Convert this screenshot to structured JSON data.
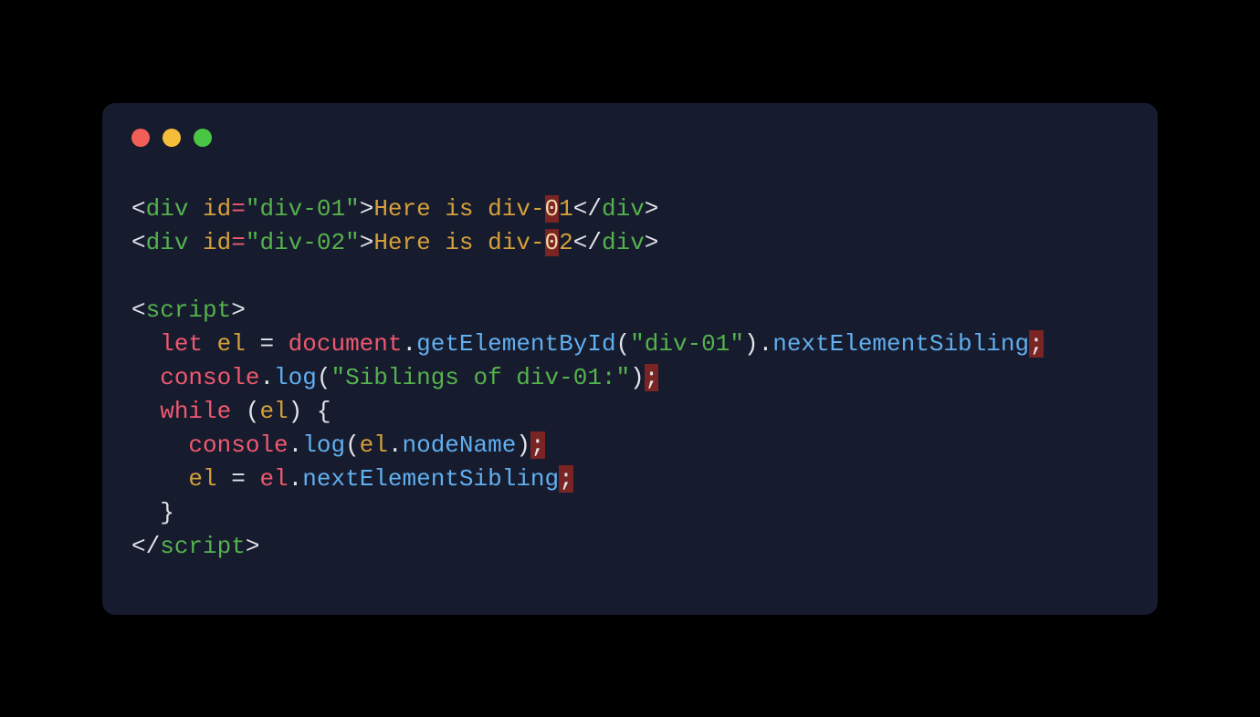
{
  "window": {
    "traffic_lights": {
      "red": "#f25f57",
      "yellow": "#f6bd3b",
      "green": "#4ac645"
    }
  },
  "code": {
    "l1": {
      "open": "<",
      "tag": "div",
      "sp": " ",
      "attr": "id",
      "eq": "=",
      "q": "\"",
      "val": "div-01",
      "gt": ">",
      "txt1": "Here is div-",
      "hz": "0",
      "txt2": "1",
      "clo": "</",
      "ct": "div",
      "cgt": ">"
    },
    "l2": {
      "open": "<",
      "tag": "div",
      "sp": " ",
      "attr": "id",
      "eq": "=",
      "q": "\"",
      "val": "div-02",
      "gt": ">",
      "txt1": "Here is div-",
      "hz": "0",
      "txt2": "2",
      "clo": "</",
      "ct": "div",
      "cgt": ">"
    },
    "l3": "",
    "l4": {
      "open": "<",
      "tag": "script",
      "gt": ">"
    },
    "l5": {
      "ind": "  ",
      "kw": "let",
      "sp": " ",
      "v": "el",
      "eq": " = ",
      "obj": "document",
      "dot": ".",
      "fn": "getElementById",
      "lp": "(",
      "q": "\"",
      "arg": "div-01",
      "rp": ")",
      "dot2": ".",
      "prop": "nextElementSibling",
      "sc": ";"
    },
    "l6": {
      "ind": "  ",
      "obj": "console",
      "dot": ".",
      "fn": "log",
      "lp": "(",
      "q": "\"",
      "arg": "Siblings of div-01:",
      "rp": ")",
      "sc": ";"
    },
    "l7": {
      "ind": "  ",
      "kw": "while",
      "sp": " ",
      "lp": "(",
      "v": "el",
      "rp": ")",
      "sp2": " ",
      "br": "{"
    },
    "l8": {
      "ind": "    ",
      "obj": "console",
      "dot": ".",
      "fn": "log",
      "lp": "(",
      "v": "el",
      "dot2": ".",
      "prop": "nodeName",
      "rp": ")",
      "sc": ";"
    },
    "l9": {
      "ind": "    ",
      "v": "el",
      "eq": " = ",
      "v2": "el",
      "dot": ".",
      "prop": "nextElementSibling",
      "sc": ";"
    },
    "l10": {
      "ind": "  ",
      "br": "}"
    },
    "l11": {
      "open": "</",
      "tag": "script",
      "gt": ">"
    }
  }
}
